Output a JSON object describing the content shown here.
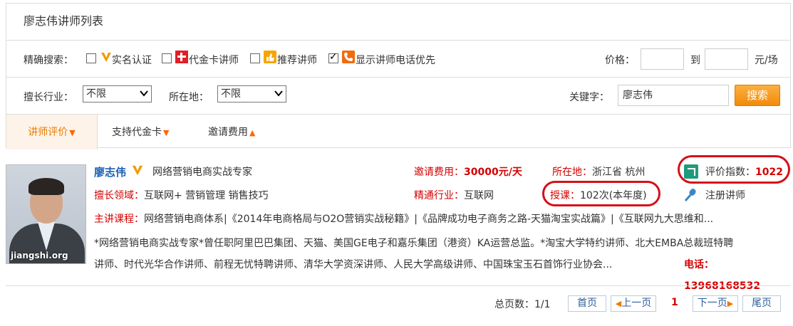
{
  "page_title": "廖志伟讲师列表",
  "filters": {
    "exact_label": "精确搜索：",
    "options": [
      {
        "label": "实名认证",
        "checked": false,
        "icon": "v-verified-icon"
      },
      {
        "label": "代金卡讲师",
        "checked": false,
        "icon": "voucher-card-icon"
      },
      {
        "label": "推荐讲师",
        "checked": false,
        "icon": "thumbs-up-icon"
      },
      {
        "label": "显示讲师电话优先",
        "checked": true,
        "icon": "phone-icon"
      }
    ],
    "price_label": "价格：",
    "price_to": "到",
    "price_unit": "元/场",
    "industry_label": "擅长行业：",
    "industry_value": "不限",
    "location_label": "所在地：",
    "location_value": "不限",
    "keyword_label": "关键字：",
    "keyword_value": "廖志伟",
    "search_label": "搜索"
  },
  "sort_tabs": [
    {
      "label": "讲师评价",
      "arrow": "down",
      "active": true
    },
    {
      "label": "支持代金卡",
      "arrow": "down",
      "active": false
    },
    {
      "label": "邀请费用",
      "arrow": "up",
      "active": false
    }
  ],
  "teacher": {
    "name": "廖志伟",
    "title": "网络营销电商实战专家",
    "watermark": "jiangshi.org",
    "fee_label": "邀请费用：",
    "fee_value": "30000元/天",
    "location_label": "所在地：",
    "location_value": "浙江省 杭州",
    "score_label": "评价指数：",
    "score_value": "1022",
    "field_label": "擅长领域：",
    "field_value": "互联网+ 营销管理 销售技巧",
    "industry_label": "精通行业：",
    "industry_value": "互联网",
    "lessons_label": "授课：",
    "lessons_value": "102次(本年度)",
    "register_label": "注册讲师",
    "courses_label": "主讲课程：",
    "courses_value": "网络营销电商体系|《2014年电商格局与O2O营销实战秘籍》|《品牌成功电子商务之路-天猫淘宝实战篇》|《互联网九大思维和...",
    "desc_line1": "*网络营销电商实战专家*曾任职阿里巴巴集团、天猫、美国GE电子和嘉乐集团（港资）KA运营总监。*淘宝大学特约讲师、北大EMBA总裁班特聘",
    "desc_line2": "讲师、时代光华合作讲师、前程无忧特聘讲师、清华大学资深讲师、人民大学高级讲师、中国珠宝玉石首饰行业协会...",
    "phone_label": "电话：",
    "phone_value": "13968168532"
  },
  "pagination": {
    "total_label": "总页数：",
    "total_value": "1/1",
    "first": "首页",
    "prev": "上一页",
    "current": "1",
    "next": "下一页",
    "last": "尾页"
  }
}
